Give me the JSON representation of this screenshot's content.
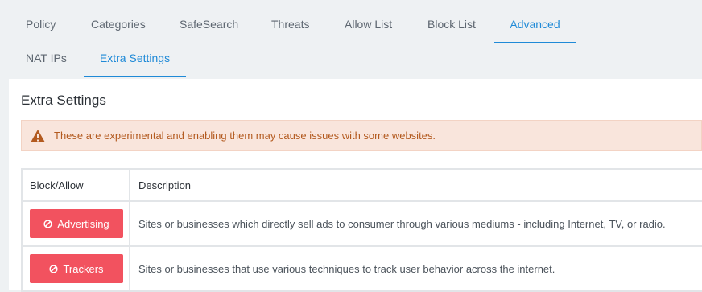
{
  "tabs_row1": [
    {
      "label": "Policy",
      "active": false
    },
    {
      "label": "Categories",
      "active": false
    },
    {
      "label": "SafeSearch",
      "active": false
    },
    {
      "label": "Threats",
      "active": false
    },
    {
      "label": "Allow List",
      "active": false
    },
    {
      "label": "Block List",
      "active": false
    },
    {
      "label": "Advanced",
      "active": true
    }
  ],
  "tabs_row2": [
    {
      "label": "NAT IPs",
      "active": false
    },
    {
      "label": "Extra Settings",
      "active": true
    }
  ],
  "panel": {
    "title": "Extra Settings",
    "alert": {
      "icon": "warning-triangle-icon",
      "text": "These are experimental and enabling them may cause issues with some websites."
    },
    "table": {
      "headers": [
        "Block/Allow",
        "Description"
      ],
      "rows": [
        {
          "button_label": "Advertising",
          "button_icon": "block-circle-icon",
          "description": "Sites or businesses which directly sell ads to consumer through various mediums - including Internet, TV, or radio."
        },
        {
          "button_label": "Trackers",
          "button_icon": "block-circle-icon",
          "description": "Sites or businesses that use various techniques to track user behavior across the internet."
        }
      ]
    }
  },
  "colors": {
    "accent": "#1f8ad7",
    "block_button": "#f2525f",
    "alert_bg": "#f9e5dc",
    "alert_text": "#b35a1f"
  }
}
